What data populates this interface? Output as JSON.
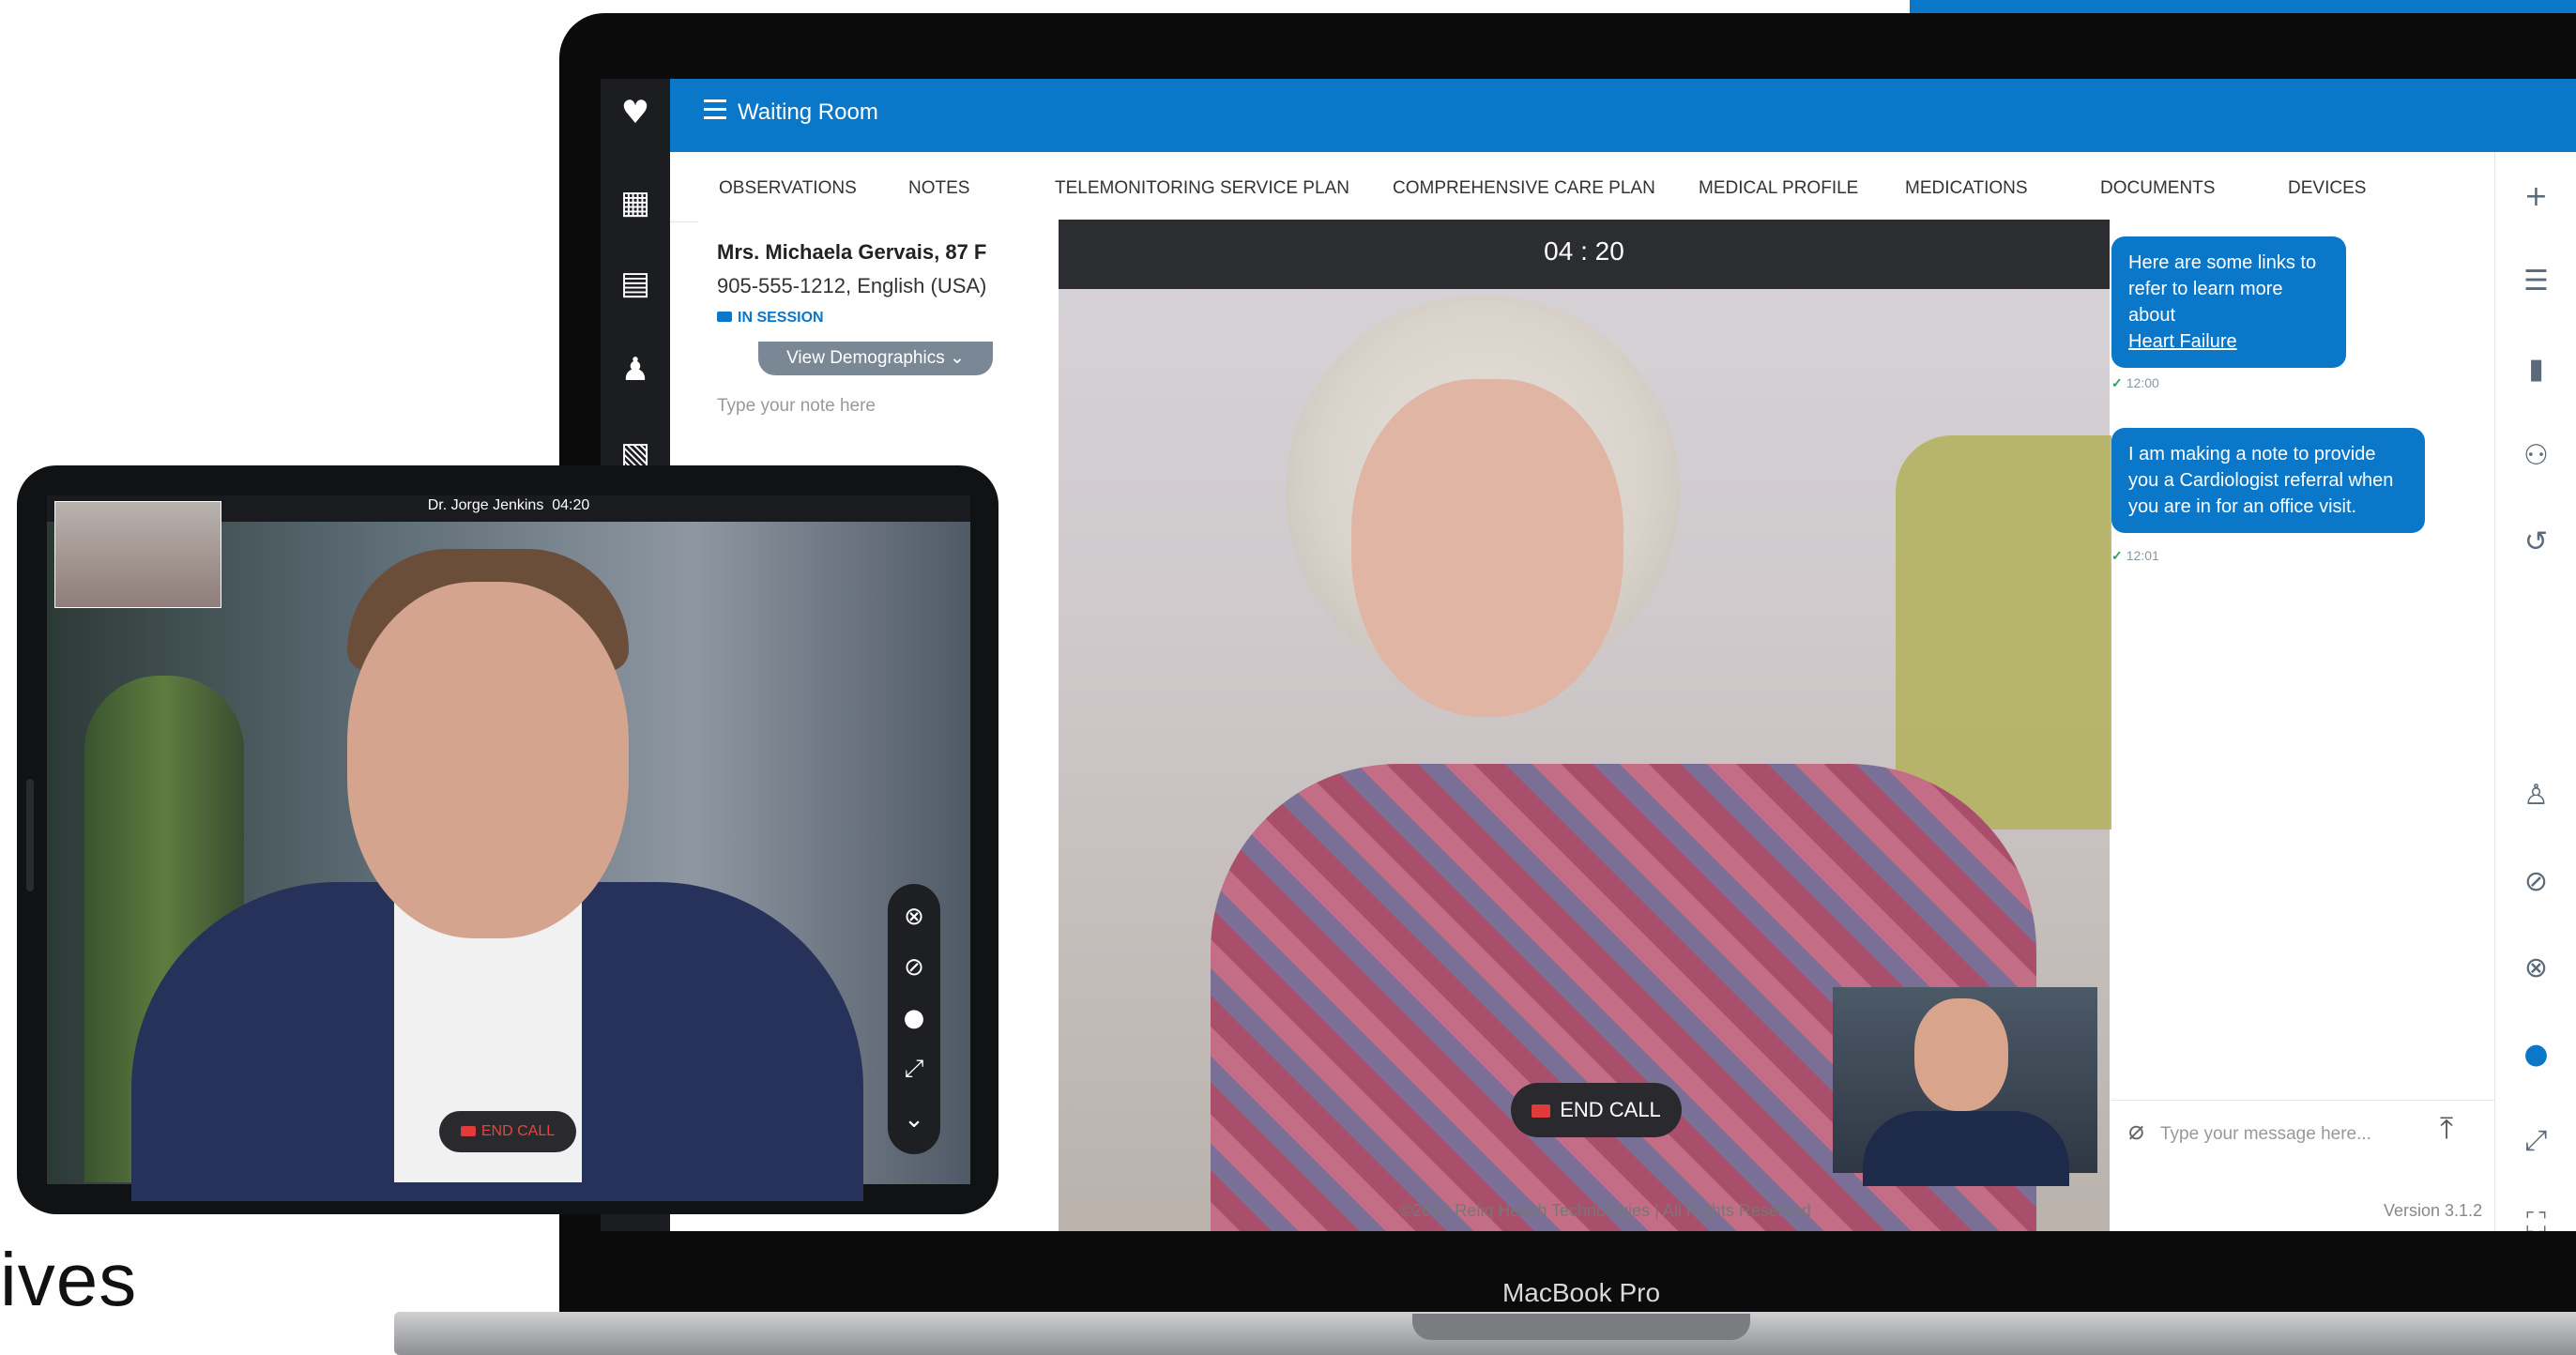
{
  "slide": {
    "partial_text": "ives"
  },
  "laptop": {
    "brand": "MacBook Pro"
  },
  "app": {
    "header_title": "Waiting Room",
    "tabs": [
      "OBSERVATIONS",
      "NOTES",
      "TELEMONITORING SERVICE PLAN",
      "COMPREHENSIVE CARE PLAN",
      "MEDICAL PROFILE",
      "MEDICATIONS",
      "DOCUMENTS",
      "DEVICES"
    ],
    "patient": {
      "name": "Mrs. Michaela Gervais, 87 F",
      "info": "905-555-1212, English (USA)",
      "status": "IN SESSION",
      "demographics_button": "View Demographics ⌄",
      "note_placeholder": "Type your note here"
    },
    "video": {
      "timer": "04 : 20",
      "end_call": "END CALL"
    },
    "chat": {
      "messages": [
        {
          "text": "Here are some links to refer to learn more about",
          "link": "Heart Failure",
          "time": "12:00"
        },
        {
          "text": "I am making a note to provide you a Cardiologist referral when you are in for an office visit.",
          "time": "12:01"
        }
      ],
      "input_placeholder": "Type your message here..."
    },
    "footer": {
      "copyright": "©2019 Reliq Health Technologies | All Rights Reserved",
      "version": "Version 3.1.2"
    },
    "colors": {
      "primary": "#0b77c9",
      "nav_bg": "#1c1d21",
      "end_call_red": "#e03a3a"
    }
  },
  "tablet": {
    "caller": "Dr. Jorge Jenkins",
    "timer": "04:20",
    "end_call": "END CALL"
  },
  "icons": {
    "left_nav": [
      "logo-icon",
      "dashboard-icon",
      "contact-card-icon",
      "patients-icon",
      "documents-icon"
    ],
    "right_rail": [
      "add-icon",
      "list-icon",
      "report-icon",
      "group-icon",
      "history-icon",
      "person-icon",
      "video-off-icon",
      "mic-off-icon",
      "chat-icon",
      "expand-icon",
      "fullscreen-icon"
    ],
    "tablet_controls": [
      "mic-off-icon",
      "video-off-icon",
      "chat-icon",
      "expand-icon",
      "chevron-down-icon"
    ]
  }
}
